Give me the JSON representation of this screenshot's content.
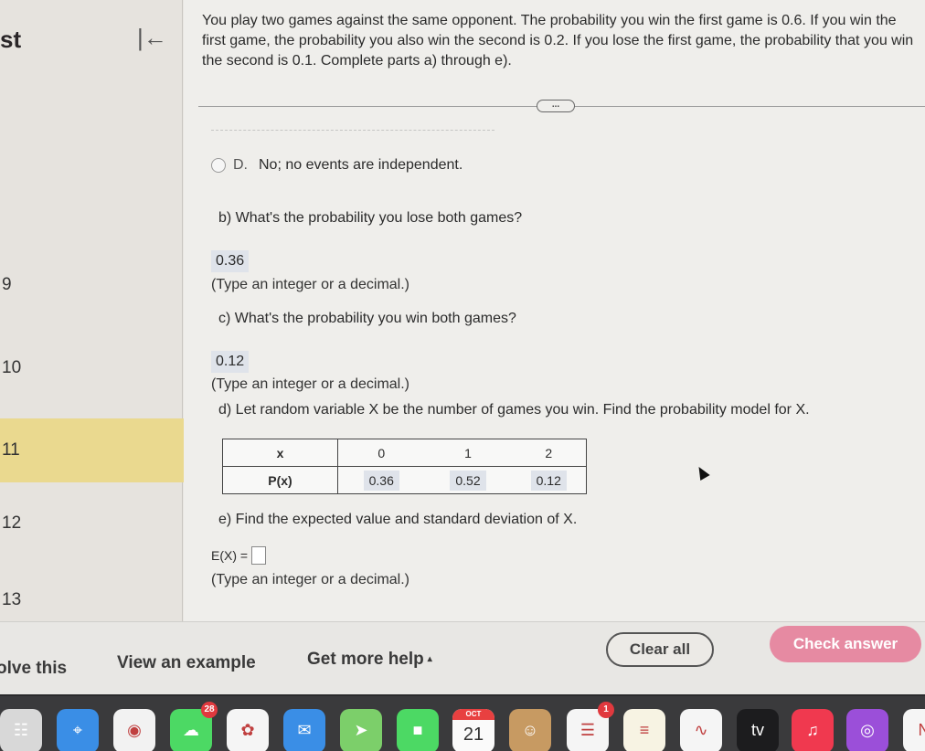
{
  "sidebar": {
    "title_fragment": "st",
    "collapse_icon": "collapse-left-arrow",
    "items": [
      {
        "label": "9",
        "active": false
      },
      {
        "label": "10",
        "active": false
      },
      {
        "label": "11",
        "active": true
      },
      {
        "label": "12",
        "active": false
      },
      {
        "label": "13",
        "active": false
      }
    ]
  },
  "problem": {
    "statement": "You play two games against the same opponent. The probability you win the first game is 0.6. If you win the first game, the probability you also win the second is 0.2. If you lose the first game, the probability that you win the second is 0.1. Complete parts a) through e).",
    "more_button": "..."
  },
  "part_a": {
    "option_d": {
      "letter": "D.",
      "text": "No; no events are independent."
    }
  },
  "part_b": {
    "question": "b) What's the probability you lose both games?",
    "answer": "0.36",
    "hint": "(Type an integer or a decimal.)"
  },
  "part_c": {
    "question": "c) What's the probability you win both games?",
    "answer": "0.12",
    "hint": "(Type an integer or a decimal.)"
  },
  "part_d": {
    "question": "d) Let random variable X be the number of games you win. Find the probability model for X.",
    "table": {
      "row_headers": [
        "x",
        "P(x)"
      ],
      "x_values": [
        "0",
        "1",
        "2"
      ],
      "p_values": [
        "0.36",
        "0.52",
        "0.12"
      ]
    }
  },
  "part_e": {
    "question": "e) Find the expected value and standard deviation of X.",
    "ex_label": "E(X) =",
    "ex_value": "",
    "hint": "(Type an integer or a decimal.)"
  },
  "footer": {
    "solve_this": "olve this",
    "view_example": "View an example",
    "get_more_help": "Get more help",
    "help_caret": "▴",
    "clear_all": "Clear all",
    "check_answer": "Check answer",
    "check_color": "#e68aa2"
  },
  "dock": {
    "apps": [
      {
        "name": "launchpad",
        "glyph": "☷",
        "bg": "#d8d8d8"
      },
      {
        "name": "safari",
        "glyph": "⌖",
        "bg": "#3a8ee6"
      },
      {
        "name": "chrome",
        "glyph": "◉",
        "bg": "#f2f2f2"
      },
      {
        "name": "messages",
        "glyph": "☁",
        "bg": "#4cd964",
        "badge": "28"
      },
      {
        "name": "photos",
        "glyph": "✿",
        "bg": "#f5f5f5"
      },
      {
        "name": "mail",
        "glyph": "✉",
        "bg": "#3a8ee6"
      },
      {
        "name": "maps",
        "glyph": "➤",
        "bg": "#7ccf6a"
      },
      {
        "name": "facetime",
        "glyph": "■",
        "bg": "#4cd964"
      },
      {
        "name": "calendar",
        "month": "OCT",
        "day": "21",
        "bg": "#fafafa"
      },
      {
        "name": "contacts",
        "glyph": "☺",
        "bg": "#c79a62"
      },
      {
        "name": "reminders",
        "glyph": "☰",
        "bg": "#f5f5f5",
        "badge": "1"
      },
      {
        "name": "notes",
        "glyph": "≡",
        "bg": "#f7f3e3"
      },
      {
        "name": "freeform",
        "glyph": "∿",
        "bg": "#f5f5f5"
      },
      {
        "name": "tv",
        "glyph": "tv",
        "bg": "#1c1c1e"
      },
      {
        "name": "music",
        "glyph": "♫",
        "bg": "#f0394f"
      },
      {
        "name": "podcasts",
        "glyph": "◎",
        "bg": "#9b4fd9"
      },
      {
        "name": "news",
        "glyph": "N",
        "bg": "#f5f5f5"
      }
    ]
  }
}
